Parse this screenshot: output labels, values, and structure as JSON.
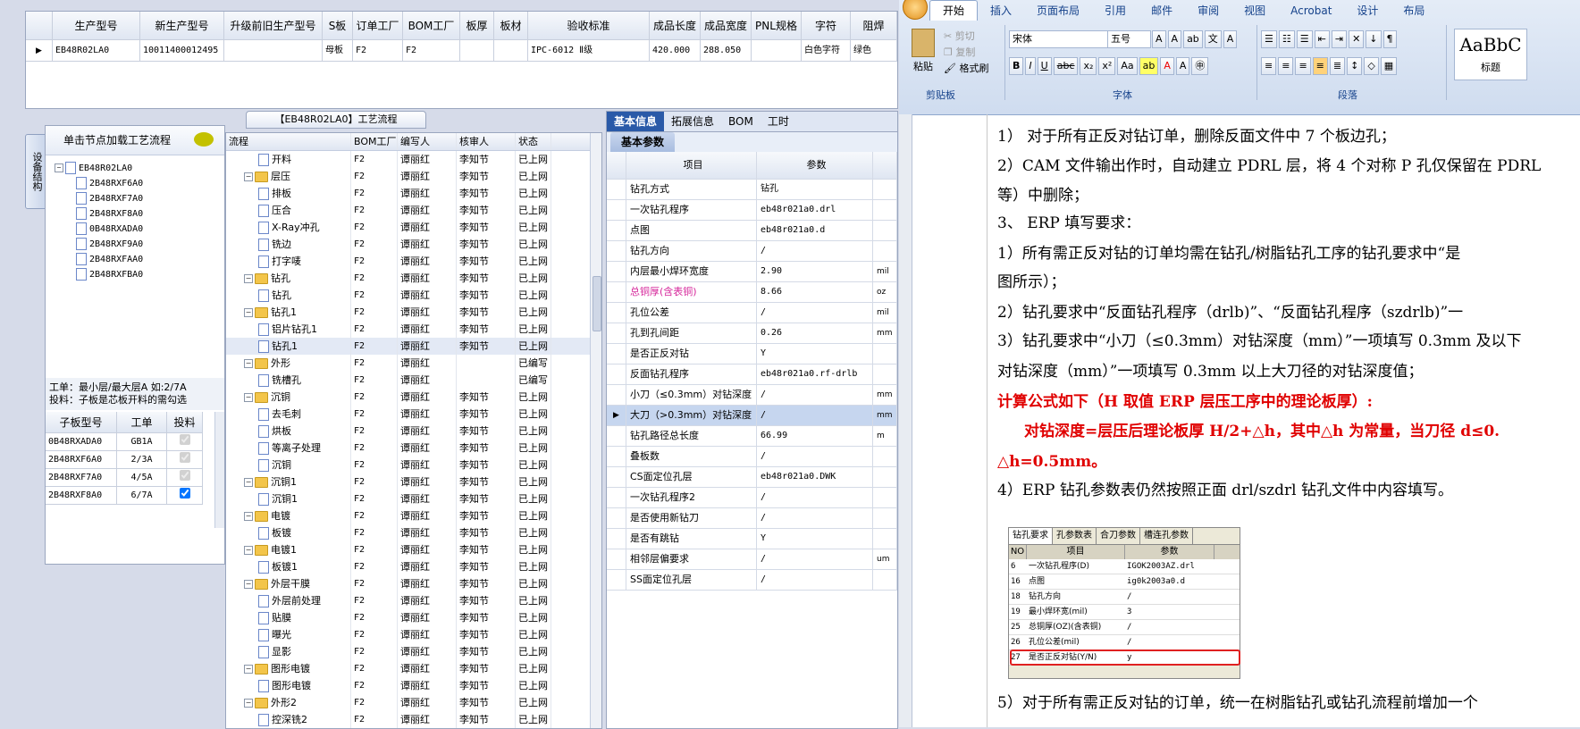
{
  "top_grid": {
    "columns": [
      "生产型号",
      "新生产型号",
      "升级前旧生产型号",
      "S板",
      "订单工厂",
      "BOM工厂",
      "板厚",
      "板材",
      "验收标准",
      "成品长度",
      "成品宽度",
      "PNL规格",
      "字符",
      "阻焊"
    ],
    "row": [
      "EB48R02LA0",
      "10011400012495",
      "",
      "母板",
      "F2",
      "F2",
      "",
      "",
      "IPC-6012 Ⅱ级",
      "420.000",
      "288.050",
      "",
      "白色字符",
      "绿色"
    ]
  },
  "left": {
    "vertical_tab": "设备结构",
    "header": "单击节点加载工艺流程",
    "tree_root": "EB48R02LA0",
    "tree_children": [
      "2B48RXF6A0",
      "2B48RXF7A0",
      "2B48RXF8A0",
      "0B48RXADA0",
      "2B48RXF9A0",
      "2B48RXFAA0",
      "2B48RXFBA0"
    ],
    "note_line1": "工单：最小层/最大层A  如:2/7A",
    "note_line2": "投料：子板是芯板开料的需勾选",
    "sub_columns": [
      "子板型号",
      "工单",
      "投料"
    ],
    "sub_rows": [
      {
        "model": "0B48RXADA0",
        "order": "GB1A"
      },
      {
        "model": "2B48RXF6A0",
        "order": "2/3A"
      },
      {
        "model": "2B48RXF7A0",
        "order": "4/5A"
      },
      {
        "model": "2B48RXF8A0",
        "order": "6/7A"
      }
    ]
  },
  "flow": {
    "title": "【EB48R02LA0】工艺流程",
    "columns": [
      "流程",
      "BOM工厂",
      "编写人",
      "核审人",
      "状态"
    ],
    "rows": [
      {
        "level": 1,
        "type": "doc",
        "name": "开料",
        "bom": "F2",
        "author": "谭丽红",
        "reviewer": "李知节",
        "status": "已上网"
      },
      {
        "level": 0,
        "type": "folder",
        "name": "层压",
        "bom": "F2",
        "author": "谭丽红",
        "reviewer": "李知节",
        "status": "已上网"
      },
      {
        "level": 1,
        "type": "doc",
        "name": "排板",
        "bom": "F2",
        "author": "谭丽红",
        "reviewer": "李知节",
        "status": "已上网"
      },
      {
        "level": 1,
        "type": "doc",
        "name": "压合",
        "bom": "F2",
        "author": "谭丽红",
        "reviewer": "李知节",
        "status": "已上网"
      },
      {
        "level": 1,
        "type": "doc",
        "name": "X-Ray冲孔",
        "bom": "F2",
        "author": "谭丽红",
        "reviewer": "李知节",
        "status": "已上网"
      },
      {
        "level": 1,
        "type": "doc",
        "name": "铣边",
        "bom": "F2",
        "author": "谭丽红",
        "reviewer": "李知节",
        "status": "已上网"
      },
      {
        "level": 1,
        "type": "doc",
        "name": "打字唛",
        "bom": "F2",
        "author": "谭丽红",
        "reviewer": "李知节",
        "status": "已上网"
      },
      {
        "level": 0,
        "type": "folder",
        "name": "钻孔",
        "bom": "F2",
        "author": "谭丽红",
        "reviewer": "李知节",
        "status": "已上网"
      },
      {
        "level": 1,
        "type": "doc",
        "name": "钻孔",
        "bom": "F2",
        "author": "谭丽红",
        "reviewer": "李知节",
        "status": "已上网"
      },
      {
        "level": 0,
        "type": "folder",
        "name": "钻孔1",
        "bom": "F2",
        "author": "谭丽红",
        "reviewer": "李知节",
        "status": "已上网"
      },
      {
        "level": 1,
        "type": "doc",
        "name": "铝片钻孔1",
        "bom": "F2",
        "author": "谭丽红",
        "reviewer": "李知节",
        "status": "已上网"
      },
      {
        "level": 1,
        "type": "doc",
        "name": "钻孔1",
        "bom": "F2",
        "author": "谭丽红",
        "reviewer": "李知节",
        "status": "已上网",
        "selected": true
      },
      {
        "level": 0,
        "type": "folder",
        "name": "外形",
        "bom": "F2",
        "author": "谭丽红",
        "reviewer": "",
        "status": "已编写"
      },
      {
        "level": 1,
        "type": "doc",
        "name": "铣槽孔",
        "bom": "F2",
        "author": "谭丽红",
        "reviewer": "",
        "status": "已编写"
      },
      {
        "level": 0,
        "type": "folder",
        "name": "沉铜",
        "bom": "F2",
        "author": "谭丽红",
        "reviewer": "李知节",
        "status": "已上网"
      },
      {
        "level": 1,
        "type": "doc",
        "name": "去毛刺",
        "bom": "F2",
        "author": "谭丽红",
        "reviewer": "李知节",
        "status": "已上网"
      },
      {
        "level": 1,
        "type": "doc",
        "name": "烘板",
        "bom": "F2",
        "author": "谭丽红",
        "reviewer": "李知节",
        "status": "已上网"
      },
      {
        "level": 1,
        "type": "doc",
        "name": "等离子处理",
        "bom": "F2",
        "author": "谭丽红",
        "reviewer": "李知节",
        "status": "已上网"
      },
      {
        "level": 1,
        "type": "doc",
        "name": "沉铜",
        "bom": "F2",
        "author": "谭丽红",
        "reviewer": "李知节",
        "status": "已上网"
      },
      {
        "level": 0,
        "type": "folder",
        "name": "沉铜1",
        "bom": "F2",
        "author": "谭丽红",
        "reviewer": "李知节",
        "status": "已上网"
      },
      {
        "level": 1,
        "type": "doc",
        "name": "沉铜1",
        "bom": "F2",
        "author": "谭丽红",
        "reviewer": "李知节",
        "status": "已上网"
      },
      {
        "level": 0,
        "type": "folder",
        "name": "电镀",
        "bom": "F2",
        "author": "谭丽红",
        "reviewer": "李知节",
        "status": "已上网"
      },
      {
        "level": 1,
        "type": "doc",
        "name": "板镀",
        "bom": "F2",
        "author": "谭丽红",
        "reviewer": "李知节",
        "status": "已上网"
      },
      {
        "level": 0,
        "type": "folder",
        "name": "电镀1",
        "bom": "F2",
        "author": "谭丽红",
        "reviewer": "李知节",
        "status": "已上网"
      },
      {
        "level": 1,
        "type": "doc",
        "name": "板镀1",
        "bom": "F2",
        "author": "谭丽红",
        "reviewer": "李知节",
        "status": "已上网"
      },
      {
        "level": 0,
        "type": "folder",
        "name": "外层干膜",
        "bom": "F2",
        "author": "谭丽红",
        "reviewer": "李知节",
        "status": "已上网"
      },
      {
        "level": 1,
        "type": "doc",
        "name": "外层前处理",
        "bom": "F2",
        "author": "谭丽红",
        "reviewer": "李知节",
        "status": "已上网"
      },
      {
        "level": 1,
        "type": "doc",
        "name": "贴膜",
        "bom": "F2",
        "author": "谭丽红",
        "reviewer": "李知节",
        "status": "已上网"
      },
      {
        "level": 1,
        "type": "doc",
        "name": "曝光",
        "bom": "F2",
        "author": "谭丽红",
        "reviewer": "李知节",
        "status": "已上网"
      },
      {
        "level": 1,
        "type": "doc",
        "name": "显影",
        "bom": "F2",
        "author": "谭丽红",
        "reviewer": "李知节",
        "status": "已上网"
      },
      {
        "level": 0,
        "type": "folder",
        "name": "图形电镀",
        "bom": "F2",
        "author": "谭丽红",
        "reviewer": "李知节",
        "status": "已上网"
      },
      {
        "level": 1,
        "type": "doc",
        "name": "图形电镀",
        "bom": "F2",
        "author": "谭丽红",
        "reviewer": "李知节",
        "status": "已上网"
      },
      {
        "level": 0,
        "type": "folder",
        "name": "外形2",
        "bom": "F2",
        "author": "谭丽红",
        "reviewer": "李知节",
        "status": "已上网"
      },
      {
        "level": 1,
        "type": "doc",
        "name": "控深铣2",
        "bom": "F2",
        "author": "谭丽红",
        "reviewer": "李知节",
        "status": "已上网"
      }
    ]
  },
  "params": {
    "tabs": [
      "基本信息",
      "拓展信息",
      "BOM",
      "工时"
    ],
    "subtab": "基本参数",
    "columns": [
      "项目",
      "参数"
    ],
    "rows": [
      {
        "item": "钻孔方式",
        "value": "钻孔",
        "unit": ""
      },
      {
        "item": "一次钻孔程序",
        "value": "eb48r021a0.drl",
        "unit": ""
      },
      {
        "item": "点图",
        "value": "eb48r021a0.d",
        "unit": ""
      },
      {
        "item": "钻孔方向",
        "value": "/",
        "unit": ""
      },
      {
        "item": "内层最小焊环宽度",
        "value": "2.90",
        "unit": "mil"
      },
      {
        "item": "总铜厚(含表铜)",
        "value": "8.66",
        "unit": "oz",
        "highlight": true
      },
      {
        "item": "孔位公差",
        "value": "/",
        "unit": "mil"
      },
      {
        "item": "孔到孔间距",
        "value": "0.26",
        "unit": "mm"
      },
      {
        "item": "是否正反对钻",
        "value": "Y",
        "unit": ""
      },
      {
        "item": "反面钻孔程序",
        "value": "eb48r021a0.rf-drlb",
        "unit": ""
      },
      {
        "item": "小刀（≤0.3mm）对钻深度",
        "value": "/",
        "unit": "mm"
      },
      {
        "item": "大刀（>0.3mm）对钻深度",
        "value": "/",
        "unit": "mm",
        "selected": true
      },
      {
        "item": "钻孔路径总长度",
        "value": "66.99",
        "unit": "m"
      },
      {
        "item": "叠板数",
        "value": "/",
        "unit": ""
      },
      {
        "item": "CS面定位孔层",
        "value": "eb48r021a0.DWK",
        "unit": ""
      },
      {
        "item": "一次钻孔程序2",
        "value": "/",
        "unit": ""
      },
      {
        "item": "是否使用新钻刀",
        "value": "/",
        "unit": ""
      },
      {
        "item": "是否有跳钻",
        "value": "Y",
        "unit": ""
      },
      {
        "item": "相邻层偏要求",
        "value": "/",
        "unit": "um"
      },
      {
        "item": "SS面定位孔层",
        "value": "/",
        "unit": ""
      }
    ]
  },
  "word": {
    "tabs": [
      "开始",
      "插入",
      "页面布局",
      "引用",
      "邮件",
      "审阅",
      "视图",
      "Acrobat",
      "设计",
      "布局"
    ],
    "clipboard": {
      "paste": "粘贴",
      "cut": "剪切",
      "copy": "复制",
      "format": "格式刷",
      "group": "剪贴板"
    },
    "font": {
      "name": "宋体",
      "size": "五号",
      "group": "字体"
    },
    "paragraph_group": "段落",
    "style": {
      "sample": "AaBbC",
      "label": "标题"
    },
    "lines": [
      "1） 对于所有正反对钻订单，删除反面文件中 7 个板边孔；",
      "2）CAM 文件输出作时，自动建立 PDRL 层，将 4 个对称 P 孔仅保留在 PDRL",
      "等）中删除；",
      "3、 ERP 填写要求：",
      "1）所有需正反对钻的订单均需在钻孔/树脂钻孔工序的钻孔要求中“是",
      "图所示）；",
      "2）钻孔要求中“反面钻孔程序（drlb)”、“反面钻孔程序（szdrlb)”一",
      "3）钻孔要求中“小刀（≤0.3mm）对钻深度（mm）”一项填写 0.3mm 及以下",
      "对钻深度（mm）”一项填写 0.3mm 以上大刀径的对钻深度值；",
      "计算公式如下（H 取值 ERP 层压工序中的理论板厚）:",
      "对钻深度=层压后理论板厚 H/2+△h，其中△h 为常量，当刀径 d≤0.",
      "△h=0.5mm。",
      "4）ERP 钻孔参数表仍然按照正面 drl/szdrl 钻孔文件中内容填写。",
      "5）对于所有需正反对钻的订单，统一在树脂钻孔或钻孔流程前增加一个"
    ],
    "embedded": {
      "tabs": [
        "钻孔要求",
        "孔参数表",
        "合刀参数",
        "槽连孔参数"
      ],
      "columns": [
        "NO",
        "项目",
        "参数"
      ],
      "rows": [
        [
          "6",
          "一次钻孔程序(D)",
          "IGOK2003AZ.drl"
        ],
        [
          "16",
          "点图",
          "ig0k2003a0.d"
        ],
        [
          "18",
          "钻孔方向",
          "/"
        ],
        [
          "19",
          "最小焊环宽(mil)",
          "3"
        ],
        [
          "25",
          "总铜厚(OZ)(含表铜)",
          "/"
        ],
        [
          "26",
          "孔位公差(mil)",
          "/"
        ],
        [
          "27",
          "是否正反对钻(Y/N)",
          "y"
        ]
      ]
    }
  },
  "colors": {
    "accent": "#1f4e9c",
    "red": "#e00000",
    "tab_active": "#2a5aa8",
    "highlight_text": "#d6279b"
  }
}
